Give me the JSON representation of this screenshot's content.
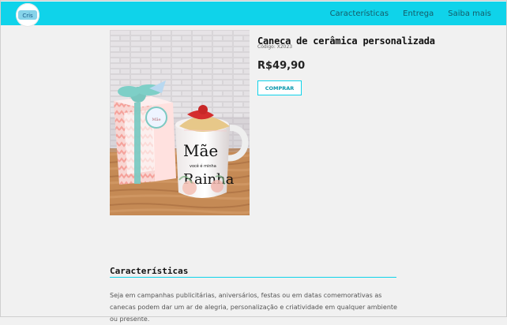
{
  "header": {
    "logo_text": "Cris",
    "nav": [
      "Características",
      "Entrega",
      "Saiba mais"
    ],
    "accent_color": "#0fd3ea"
  },
  "product": {
    "title": "Caneca de cerâmica personalizada",
    "code": "Código: X2023",
    "price": "R$49,90",
    "buy_label": "COMPRAR",
    "mug_text_line1": "Mãe",
    "mug_text_line2": "você é minha",
    "mug_text_line3": "Rainha"
  },
  "features": {
    "title": "Características",
    "text": "Seja em campanhas publicitárias, aniversários, festas ou em datas comemorativas as canecas podem dar um ar de alegria, personalização e criatividade em qualquer ambiente ou presente."
  }
}
